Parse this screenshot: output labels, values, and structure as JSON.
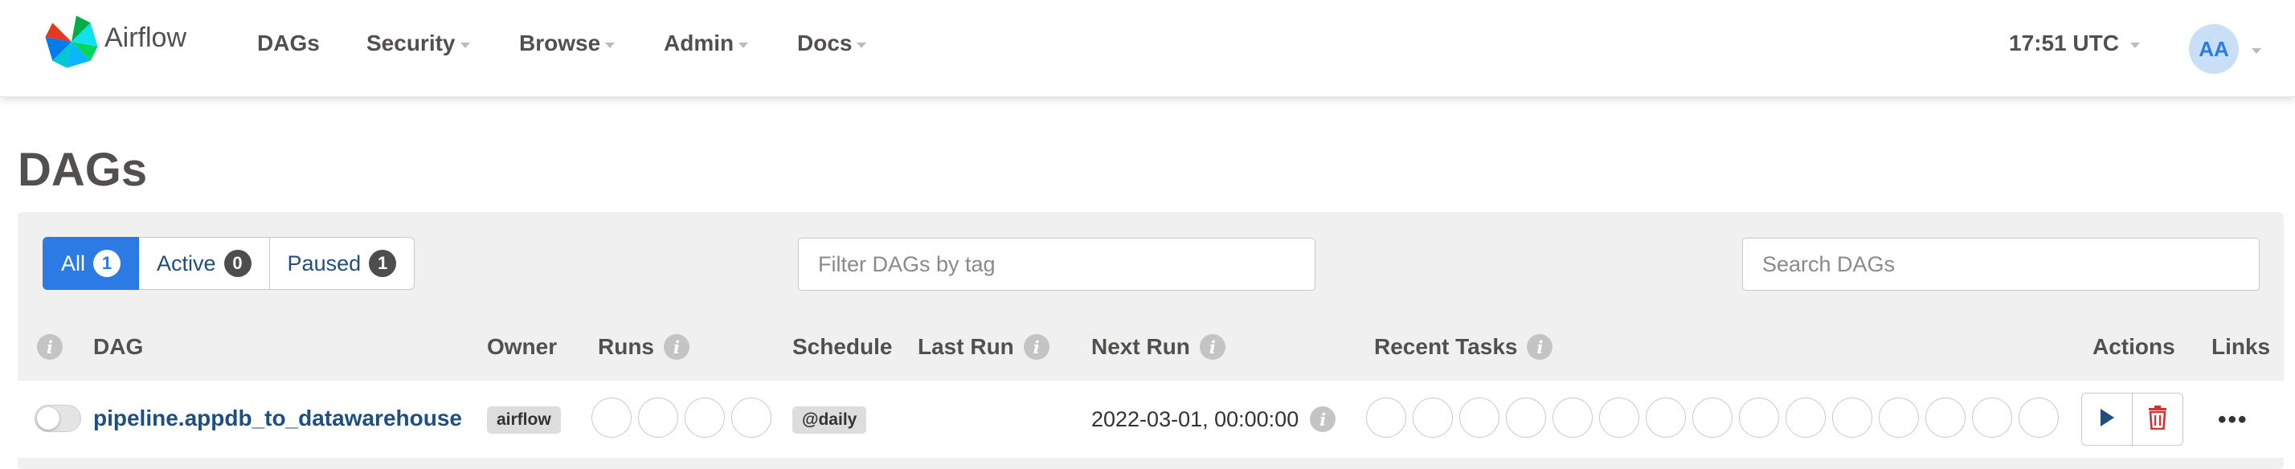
{
  "app": {
    "brand": "Airflow"
  },
  "nav": {
    "items": [
      {
        "label": "DAGs",
        "dropdown": false
      },
      {
        "label": "Security",
        "dropdown": true
      },
      {
        "label": "Browse",
        "dropdown": true
      },
      {
        "label": "Admin",
        "dropdown": true
      },
      {
        "label": "Docs",
        "dropdown": true
      }
    ],
    "clock": "17:51 UTC",
    "user_initials": "AA"
  },
  "page": {
    "title": "DAGs"
  },
  "filters": {
    "status": [
      {
        "label": "All",
        "count": "1",
        "active": true
      },
      {
        "label": "Active",
        "count": "0",
        "active": false
      },
      {
        "label": "Paused",
        "count": "1",
        "active": false
      }
    ],
    "tag_placeholder": "Filter DAGs by tag",
    "search_placeholder": "Search DAGs"
  },
  "table": {
    "columns": {
      "dag": "DAG",
      "owner": "Owner",
      "runs": "Runs",
      "schedule": "Schedule",
      "last_run": "Last Run",
      "next_run": "Next Run",
      "recent_tasks": "Recent Tasks",
      "actions": "Actions",
      "links": "Links"
    },
    "rows": [
      {
        "dag_id": "pipeline.appdb_to_datawarehouse",
        "paused": true,
        "owner": "airflow",
        "run_states_count": 4,
        "schedule": "@daily",
        "last_run": "",
        "next_run": "2022-03-01, 00:00:00",
        "task_states_count": 15,
        "links": "•••"
      }
    ]
  },
  "colors": {
    "primary": "#2c7be5",
    "link": "#1e4f80",
    "delete": "#d9302c",
    "text": "#51504f"
  }
}
